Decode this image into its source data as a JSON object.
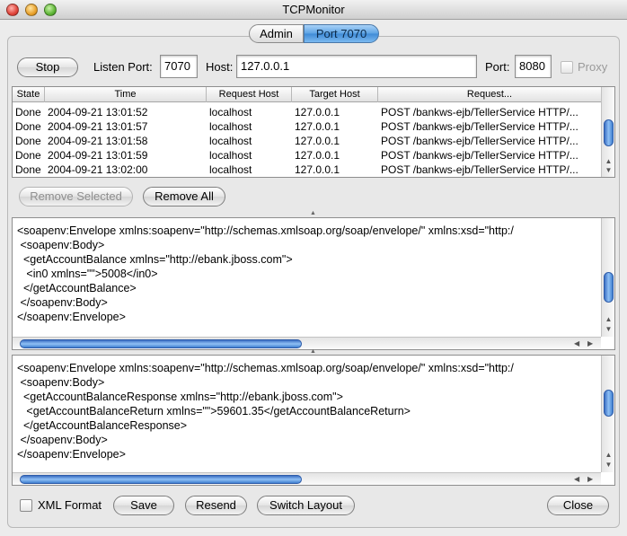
{
  "window": {
    "title": "TCPMonitor"
  },
  "tabs": [
    {
      "label": "Admin",
      "active": false
    },
    {
      "label": "Port 7070",
      "active": true
    }
  ],
  "toolbar": {
    "stop_label": "Stop",
    "listen_port_label": "Listen Port:",
    "listen_port_value": "7070",
    "host_label": "Host:",
    "host_value": "127.0.0.1",
    "port_label": "Port:",
    "port_value": "8080",
    "proxy_label": "Proxy"
  },
  "table": {
    "columns": [
      "State",
      "Time",
      "Request Host",
      "Target Host",
      "Request..."
    ],
    "rows": [
      [
        "Done",
        "2004-09-21 13:01:52",
        "localhost",
        "127.0.0.1",
        "POST /bankws-ejb/TellerService HTTP/..."
      ],
      [
        "Done",
        "2004-09-21 13:01:57",
        "localhost",
        "127.0.0.1",
        "POST /bankws-ejb/TellerService HTTP/..."
      ],
      [
        "Done",
        "2004-09-21 13:01:58",
        "localhost",
        "127.0.0.1",
        "POST /bankws-ejb/TellerService HTTP/..."
      ],
      [
        "Done",
        "2004-09-21 13:01:59",
        "localhost",
        "127.0.0.1",
        "POST /bankws-ejb/TellerService HTTP/..."
      ],
      [
        "Done",
        "2004-09-21 13:02:00",
        "localhost",
        "127.0.0.1",
        "POST /bankws-ejb/TellerService HTTP/..."
      ]
    ]
  },
  "actions": {
    "remove_selected_label": "Remove Selected",
    "remove_all_label": "Remove All"
  },
  "request_pane": {
    "lines": [
      "<soapenv:Envelope xmlns:soapenv=\"http://schemas.xmlsoap.org/soap/envelope/\" xmlns:xsd=\"http:/",
      " <soapenv:Body>",
      "  <getAccountBalance xmlns=\"http://ebank.jboss.com\">",
      "   <in0 xmlns=\"\">5008</in0>",
      "  </getAccountBalance>",
      " </soapenv:Body>",
      "</soapenv:Envelope>"
    ]
  },
  "response_pane": {
    "lines": [
      "<soapenv:Envelope xmlns:soapenv=\"http://schemas.xmlsoap.org/soap/envelope/\" xmlns:xsd=\"http:/",
      " <soapenv:Body>",
      "  <getAccountBalanceResponse xmlns=\"http://ebank.jboss.com\">",
      "   <getAccountBalanceReturn xmlns=\"\">59601.35</getAccountBalanceReturn>",
      "  </getAccountBalanceResponse>",
      " </soapenv:Body>",
      "</soapenv:Envelope>"
    ]
  },
  "bottom": {
    "xml_format_label": "XML Format",
    "save_label": "Save",
    "resend_label": "Resend",
    "switch_layout_label": "Switch Layout",
    "close_label": "Close"
  }
}
